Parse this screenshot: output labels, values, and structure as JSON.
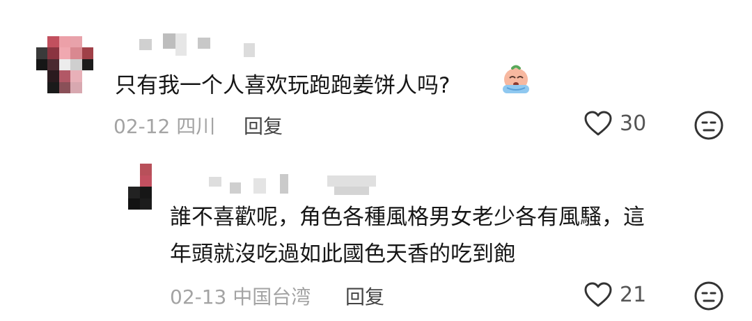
{
  "comments": [
    {
      "text": "只有我一个人喜欢玩跑跑姜饼人吗?",
      "emoji": "crying-emoji",
      "date": "02-12",
      "location": "四川",
      "reply_label": "回复",
      "likes": "30"
    }
  ],
  "reply": {
    "lines": [
      "誰不喜歡呢，角色各種風格男女老少各有風騷，這",
      "年頭就沒吃過如此國色天香的吃到飽"
    ],
    "date": "02-13",
    "location": "中国台湾",
    "reply_label": "回复",
    "likes": "21"
  },
  "colors": {
    "text": "#161616",
    "meta": "#a3a3a3",
    "icon": "#333333"
  }
}
